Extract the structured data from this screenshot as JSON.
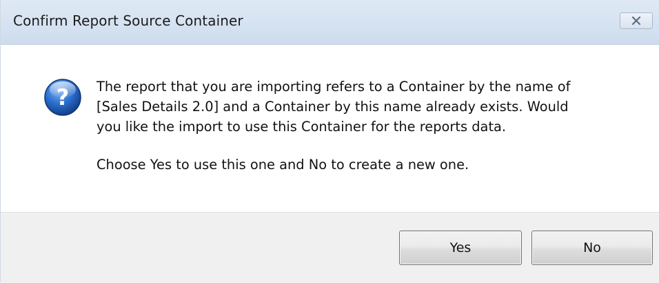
{
  "window": {
    "title": "Confirm Report Source Container",
    "close_icon": "close-icon"
  },
  "message": {
    "icon": "question-icon",
    "icon_symbol": "?",
    "lines": [
      "The report that you are importing refers to a Container by the name of",
      "[Sales Details 2.0] and a Container by this name already exists. Would",
      "you like the import to use this Container for the reports data."
    ],
    "instruction": "Choose Yes to use this one and No to create a new one."
  },
  "buttons": {
    "yes_label": "Yes",
    "no_label": "No"
  },
  "colors": {
    "titlebar": "#d6e3f2",
    "footer": "#f0f0f0",
    "icon_blue": "#1f5fb8"
  }
}
